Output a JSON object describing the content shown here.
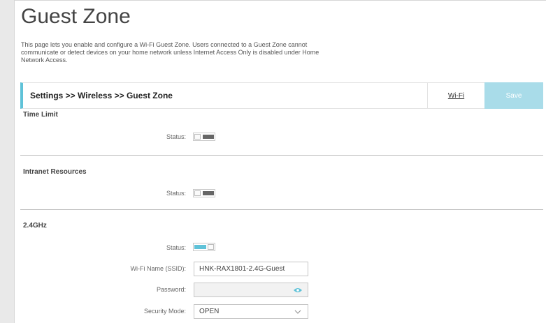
{
  "page": {
    "title": "Guest Zone",
    "description": "This page lets you enable and configure a Wi-Fi Guest Zone. Users connected to a Guest Zone cannot communicate or detect devices on your home network unless Internet Access Only is disabled under Home Network Access."
  },
  "header_bar": {
    "breadcrumb": "Settings >> Wireless >> Guest Zone",
    "wifi_link": "Wi-Fi",
    "save_label": "Save",
    "accent_color": "#5fc2d8"
  },
  "sections": {
    "time_limit": {
      "title": "Time Limit",
      "status_label": "Status:",
      "status": "off"
    },
    "intranet": {
      "title": "Intranet Resources",
      "status_label": "Status:",
      "status": "off"
    },
    "wifi_24": {
      "title": "2.4GHz",
      "status_label": "Status:",
      "status": "on",
      "ssid_label": "Wi-Fi Name (SSID):",
      "ssid_value": "HNK-RAX1801-2.4G-Guest",
      "password_label": "Password:",
      "password_value": "",
      "password_icon": "eye-icon",
      "security_label": "Security Mode:",
      "security_value": "OPEN",
      "security_icon": "chevron-down-icon"
    }
  }
}
